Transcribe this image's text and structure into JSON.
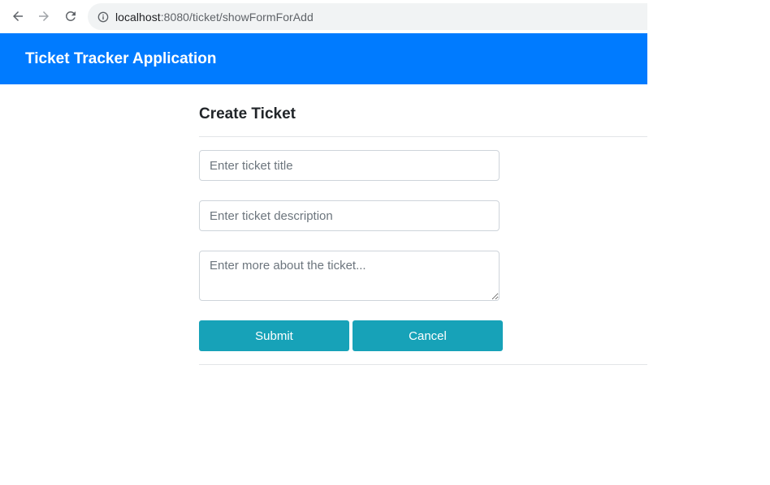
{
  "browser": {
    "url_host": "localhost",
    "url_path": ":8080/ticket/showFormForAdd",
    "icons": {
      "back": "arrow-left-icon",
      "forward": "arrow-right-icon",
      "reload": "reload-icon",
      "info": "info-icon"
    }
  },
  "header": {
    "title": "Ticket Tracker Application"
  },
  "form": {
    "title": "Create Ticket",
    "title_placeholder": "Enter ticket title",
    "description_placeholder": "Enter ticket description",
    "more_placeholder": "Enter more about the ticket...",
    "submit_label": "Submit",
    "cancel_label": "Cancel"
  },
  "colors": {
    "header_bg": "#007bff",
    "button_bg": "#17a2b8"
  }
}
